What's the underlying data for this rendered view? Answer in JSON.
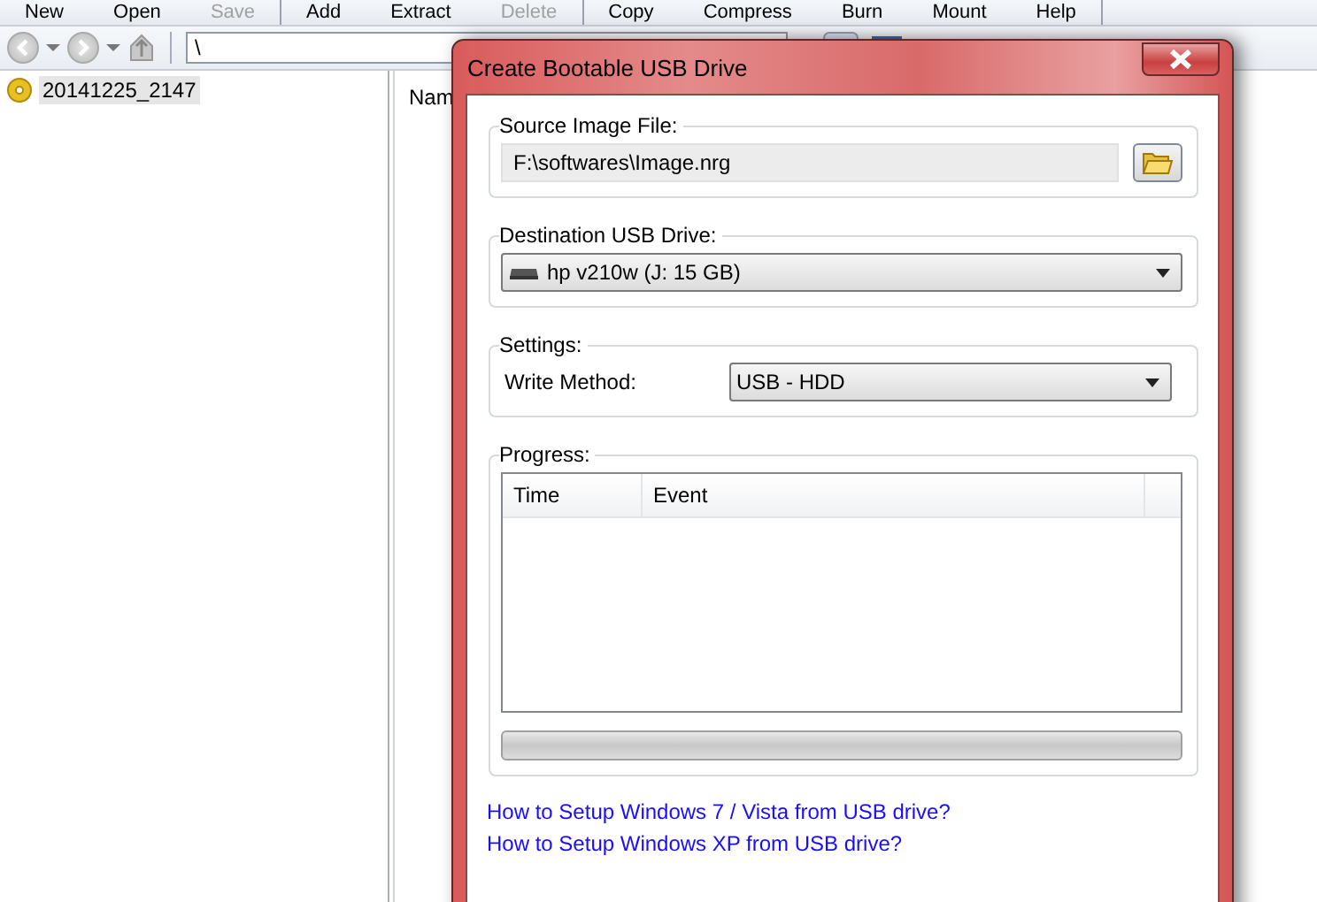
{
  "toolbar": [
    {
      "label": "New",
      "disabled": false
    },
    {
      "label": "Open",
      "disabled": false
    },
    {
      "label": "Save",
      "disabled": true
    },
    {
      "label": "Add",
      "disabled": false
    },
    {
      "label": "Extract",
      "disabled": false
    },
    {
      "label": "Delete",
      "disabled": true
    },
    {
      "label": "Copy",
      "disabled": false
    },
    {
      "label": "Compress",
      "disabled": false
    },
    {
      "label": "Burn",
      "disabled": false
    },
    {
      "label": "Mount",
      "disabled": false
    },
    {
      "label": "Help",
      "disabled": false
    }
  ],
  "address": {
    "value": "\\"
  },
  "tree": {
    "items": [
      {
        "label": "20141225_2147",
        "selected": true
      }
    ]
  },
  "file_list": {
    "columns": [
      "Nam"
    ]
  },
  "dialog": {
    "title": "Create Bootable USB Drive",
    "source_image": {
      "label": "Source Image File:",
      "value": "F:\\softwares\\Image.nrg"
    },
    "destination": {
      "label": "Destination USB Drive:",
      "value": "hp v210w (J: 15 GB)"
    },
    "settings": {
      "label": "Settings:",
      "write_method_label": "Write Method:",
      "write_method_value": "USB - HDD"
    },
    "progress": {
      "label": "Progress:",
      "columns": [
        "Time",
        "Event"
      ],
      "level": 0
    },
    "links": [
      "How to Setup Windows 7 / Vista from USB drive?",
      "How to Setup Windows XP from USB drive?"
    ]
  }
}
